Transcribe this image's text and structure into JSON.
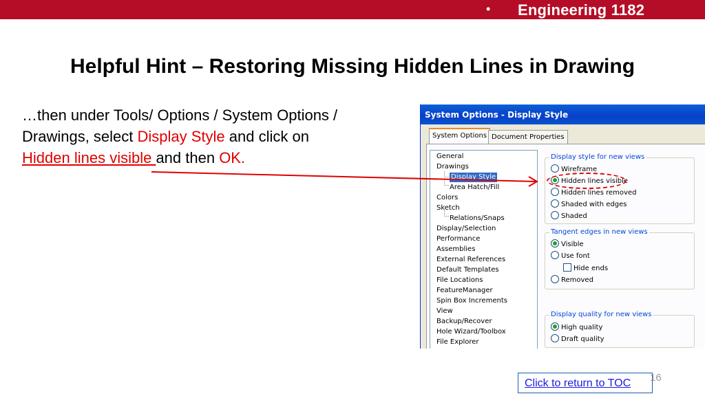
{
  "header": {
    "bullet": "•",
    "course": "Engineering 1182"
  },
  "title": "Helpful Hint – Restoring Missing Hidden Lines in Drawing",
  "body": {
    "line1": "…then under Tools/ Options / System Options /",
    "line2_a": "Drawings, select ",
    "line2_b": "Display Style",
    "line2_c": " and click on",
    "line3_a": "Hidden lines visible ",
    "line3_b": "and then ",
    "line3_c": "OK."
  },
  "dialog": {
    "title": "System Options - Display Style",
    "tabs": [
      "System Options",
      "Document Properties"
    ],
    "tree": [
      "General",
      "Drawings",
      "Display Style",
      "Area Hatch/Fill",
      "Colors",
      "Sketch",
      "Relations/Snaps",
      "Display/Selection",
      "Performance",
      "Assemblies",
      "External References",
      "Default Templates",
      "File Locations",
      "FeatureManager",
      "Spin Box Increments",
      "View",
      "Backup/Recover",
      "Hole Wizard/Toolbox",
      "File Explorer"
    ],
    "groups": {
      "display_style": {
        "label": "Display style for new views",
        "options": [
          "Wireframe",
          "Hidden lines visible",
          "Hidden lines removed",
          "Shaded with edges",
          "Shaded"
        ],
        "selected": "Hidden lines visible"
      },
      "tangent": {
        "label": "Tangent edges in new views",
        "options": [
          "Visible",
          "Use font",
          "Hide ends",
          "Removed"
        ],
        "selected": "Visible"
      },
      "quality": {
        "label": "Display quality for new views",
        "options": [
          "High quality",
          "Draft quality"
        ],
        "selected": "High quality"
      }
    }
  },
  "footer": {
    "toc_link": "Click to return to TOC",
    "page_number": "16"
  },
  "colors": {
    "accent": "#b50d27",
    "highlight": "#e00000",
    "link": "#1a1ae0"
  }
}
